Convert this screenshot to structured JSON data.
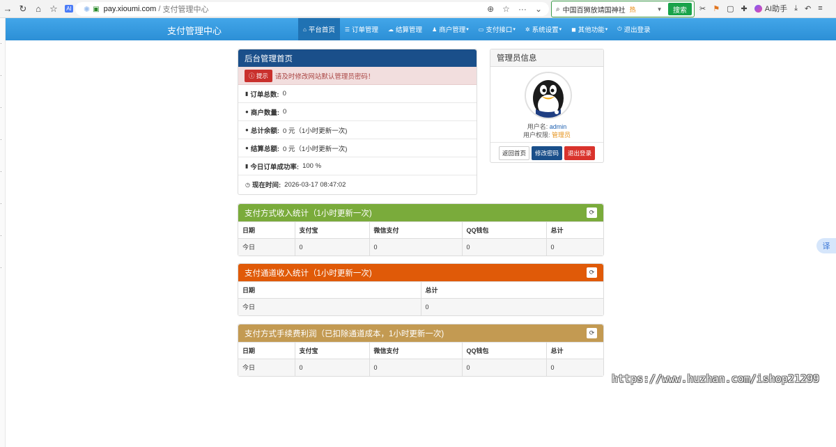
{
  "browser": {
    "url_host": "pay.xioumi.com",
    "url_sep": " / ",
    "url_path": "支付管理中心",
    "search_text": "中国百狮放靖国神社",
    "search_hot": "热",
    "search_button": "搜索",
    "ai_label": "AI助手"
  },
  "nav": {
    "brand": "支付管理中心",
    "items": [
      {
        "label": "平台首页",
        "icon": "home-icon",
        "glyph": "⌂",
        "dropdown": false
      },
      {
        "label": "订单管理",
        "icon": "list-icon",
        "glyph": "☰",
        "dropdown": false
      },
      {
        "label": "结算管理",
        "icon": "cloud-icon",
        "glyph": "☁",
        "dropdown": false
      },
      {
        "label": "商户管理",
        "icon": "user-icon",
        "glyph": "♟",
        "dropdown": true
      },
      {
        "label": "支付接口",
        "icon": "card-icon",
        "glyph": "▭",
        "dropdown": true
      },
      {
        "label": "系统设置",
        "icon": "gear-icon",
        "glyph": "✲",
        "dropdown": true
      },
      {
        "label": "其他功能",
        "icon": "briefcase-icon",
        "glyph": "◼",
        "dropdown": true
      },
      {
        "label": "退出登录",
        "icon": "power-icon",
        "glyph": "⏻",
        "dropdown": false
      }
    ]
  },
  "admin_home": {
    "title": "后台管理首页",
    "notice_tag": "提示",
    "notice_text": "请及时修改网站默认管理员密码！",
    "stats": [
      {
        "icon": "bar-chart-icon",
        "glyph": "▮",
        "label": "订单总数:",
        "value": "0"
      },
      {
        "icon": "drop-icon",
        "glyph": "●",
        "label": "商户数量:",
        "value": "0"
      },
      {
        "icon": "drop-icon",
        "glyph": "●",
        "label": "总计余额:",
        "value": "0 元（1小时更新一次)"
      },
      {
        "icon": "drop-icon",
        "glyph": "●",
        "label": "结算总额:",
        "value": "0 元（1小时更新一次)"
      },
      {
        "icon": "bar-chart-icon",
        "glyph": "▮",
        "label": "今日订单成功率:",
        "value": "100 %"
      },
      {
        "icon": "clock-icon",
        "glyph": "◷",
        "label": "现在时间:",
        "value": "2026-03-17 08:47:02"
      }
    ]
  },
  "admin_info": {
    "title": "管理员信息",
    "username_label": "用户名:",
    "username": "admin",
    "role_label": "用户权限:",
    "role": "管理员",
    "btn_home": "返回首页",
    "btn_password": "修改密码",
    "btn_logout": "退出登录"
  },
  "colors": {
    "nav": "#2c8fd6",
    "home_head": "#1a4f8a",
    "green_head": "#7aab3b",
    "orange_head": "#e05a08",
    "gold_head": "#c39a52"
  },
  "method_income": {
    "title": "支付方式收入统计（1小时更新一次)",
    "headers": [
      "日期",
      "支付宝",
      "微信支付",
      "QQ钱包",
      "总计"
    ],
    "rows": [
      [
        "今日",
        "0",
        "0",
        "0",
        "0"
      ]
    ]
  },
  "channel_income": {
    "title": "支付通道收入统计（1小时更新一次)",
    "headers": [
      "日期",
      "总计"
    ],
    "rows": [
      [
        "今日",
        "0"
      ]
    ]
  },
  "fee_profit": {
    "title": "支付方式手续费利润（已扣除通道成本，1小时更新一次)",
    "headers": [
      "日期",
      "支付宝",
      "微信支付",
      "QQ钱包",
      "总计"
    ],
    "rows": [
      [
        "今日",
        "0",
        "0",
        "0",
        "0"
      ]
    ]
  },
  "watermark": "https://www.huzhan.com/ishop21299",
  "translate_label": "译"
}
